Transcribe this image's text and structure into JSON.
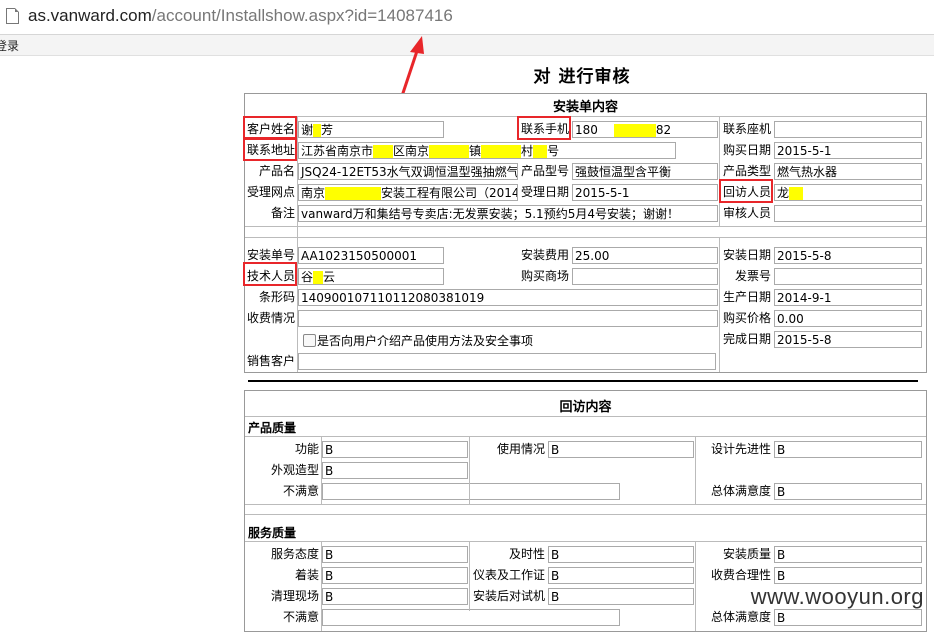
{
  "browser": {
    "url_host": "as.vanward.com",
    "url_path": "/account/Installshow.aspx?id=14087416",
    "bookmark": "登录"
  },
  "page": {
    "title": "对 进行审核"
  },
  "install": {
    "section_title": "安装单内容",
    "customer_name_label": "客户姓名",
    "customer_name_a": "谢",
    "customer_name_b": "芳",
    "phone_label": "联系手机",
    "phone_a": "180",
    "phone_b": "82",
    "landline_label": "联系座机",
    "landline": "",
    "address_label": "联系地址",
    "address_a": "江苏省南京市",
    "address_b": "区南京",
    "address_c": "镇",
    "address_d": "村",
    "address_e": "号",
    "buy_date_label": "购买日期",
    "buy_date": "2015-5-1",
    "product_name_label": "产品名",
    "product_name": "JSQ24-12ET53水气双调恒温型强抽燃气",
    "model_label": "产品型号",
    "model": "强鼓恒温型含平衡",
    "product_type_label": "产品类型",
    "product_type": "燃气热水器",
    "outlet_label": "受理网点",
    "outlet_a": "南京",
    "outlet_b": "安装工程有限公司（2014",
    "accept_date_label": "受理日期",
    "accept_date": "2015-5-1",
    "visitor_label": "回访人员",
    "visitor": "龙",
    "remark_label": "备注",
    "remark": "vanward万和集结号专卖店:无发票安装；5.1预约5月4号安装；谢谢！",
    "auditor_label": "审核人员",
    "auditor": "",
    "install_no_label": "安装单号",
    "install_no": "AA1023150500001",
    "install_fee_label": "安装费用",
    "install_fee": "25.00",
    "install_date_label": "安装日期",
    "install_date": "2015-5-8",
    "tech_label": "技术人员",
    "tech_a": "谷",
    "tech_b": "云",
    "store_label": "购买商场",
    "store": "",
    "invoice_label": "发票号",
    "invoice": "",
    "barcode_label": "条形码",
    "barcode": "140900107110112080381019",
    "prod_date_label": "生产日期",
    "prod_date": "2014-9-1",
    "charge_label": "收费情况",
    "charge": "",
    "price_label": "购买价格",
    "price": "0.00",
    "checkbox_label": "是否向用户介绍产品使用方法及安全事项",
    "done_date_label": "完成日期",
    "done_date": "2015-5-8",
    "sales_customer_label": "销售客户",
    "sales_customer": ""
  },
  "visit": {
    "section_title": "回访内容",
    "quality_title": "产品质量",
    "func_label": "功能",
    "func": "B",
    "use_label": "使用情况",
    "use": "B",
    "design_label": "设计先进性",
    "design": "B",
    "look_label": "外观造型",
    "look": "B",
    "unsat1_label": "不满意",
    "unsat1": "",
    "total1_label": "总体满意度",
    "total1": "B",
    "service_title": "服务质量",
    "attitude_label": "服务态度",
    "attitude": "B",
    "timely_label": "及时性",
    "timely": "B",
    "inst_quality_label": "安装质量",
    "inst_quality": "B",
    "dress_label": "着装",
    "dress": "B",
    "tools_label": "仪表及工作证",
    "tools": "B",
    "fee_reason_label": "收费合理性",
    "fee_reason": "B",
    "clean_label": "清理现场",
    "clean": "B",
    "test_label": "安装后对试机",
    "test": "B",
    "unsat2_label": "不满意",
    "unsat2": "",
    "total2_label": "总体满意度",
    "total2": "B"
  },
  "watermark": "www.wooyun.org",
  "colors": {
    "highlight": "#ffff00",
    "annotation_red": "#e8262a"
  }
}
